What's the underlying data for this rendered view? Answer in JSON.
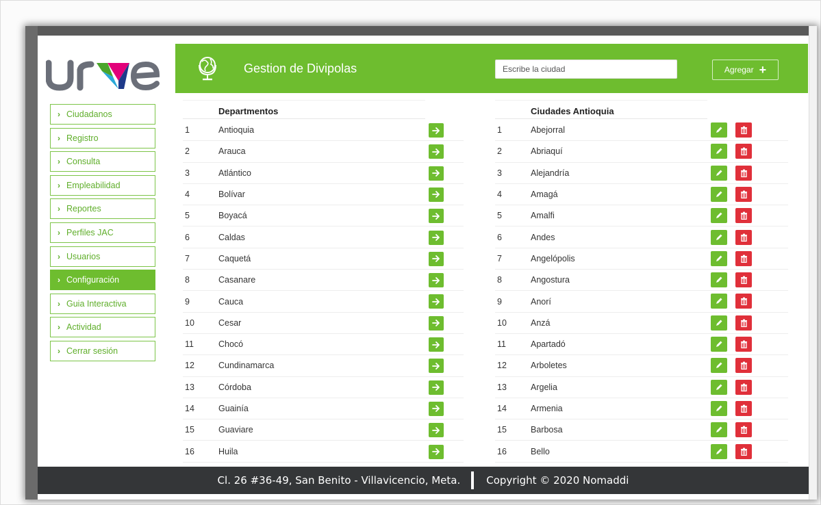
{
  "brand": {
    "logo_text": "URVE"
  },
  "header": {
    "title": "Gestion de Divipolas",
    "search_placeholder": "Escribe la ciudad",
    "add_label": "Agregar",
    "accent_color": "#6ebd2f"
  },
  "sidebar": {
    "items": [
      {
        "label": "Ciudadanos",
        "active": false
      },
      {
        "label": "Registro",
        "active": false
      },
      {
        "label": "Consulta",
        "active": false
      },
      {
        "label": "Empleabilidad",
        "active": false
      },
      {
        "label": "Reportes",
        "active": false
      },
      {
        "label": "Perfiles JAC",
        "active": false
      },
      {
        "label": "Usuarios",
        "active": false
      },
      {
        "label": "Configuración",
        "active": true
      },
      {
        "label": "Guia Interactiva",
        "active": false
      },
      {
        "label": "Actividad",
        "active": false
      },
      {
        "label": "Cerrar sesión",
        "active": false
      }
    ]
  },
  "departments": {
    "header": "Departmentos",
    "rows": [
      {
        "num": "1",
        "name": "Antioquia"
      },
      {
        "num": "2",
        "name": "Arauca"
      },
      {
        "num": "3",
        "name": "Atlántico"
      },
      {
        "num": "4",
        "name": "Bolívar"
      },
      {
        "num": "5",
        "name": "Boyacá"
      },
      {
        "num": "6",
        "name": "Caldas"
      },
      {
        "num": "7",
        "name": "Caquetá"
      },
      {
        "num": "8",
        "name": "Casanare"
      },
      {
        "num": "9",
        "name": "Cauca"
      },
      {
        "num": "10",
        "name": "Cesar"
      },
      {
        "num": "11",
        "name": "Chocó"
      },
      {
        "num": "12",
        "name": "Cundinamarca"
      },
      {
        "num": "13",
        "name": "Córdoba"
      },
      {
        "num": "14",
        "name": "Guainía"
      },
      {
        "num": "15",
        "name": "Guaviare"
      },
      {
        "num": "16",
        "name": "Huila"
      }
    ]
  },
  "cities": {
    "header": "Ciudades Antioquia",
    "rows": [
      {
        "num": "1",
        "name": "Abejorral"
      },
      {
        "num": "2",
        "name": "Abriaquí"
      },
      {
        "num": "3",
        "name": "Alejandría"
      },
      {
        "num": "4",
        "name": "Amagá"
      },
      {
        "num": "5",
        "name": "Amalfi"
      },
      {
        "num": "6",
        "name": "Andes"
      },
      {
        "num": "7",
        "name": "Angelópolis"
      },
      {
        "num": "8",
        "name": "Angostura"
      },
      {
        "num": "9",
        "name": "Anorí"
      },
      {
        "num": "10",
        "name": "Anzá"
      },
      {
        "num": "11",
        "name": "Apartadó"
      },
      {
        "num": "12",
        "name": "Arboletes"
      },
      {
        "num": "13",
        "name": "Argelia"
      },
      {
        "num": "14",
        "name": "Armenia"
      },
      {
        "num": "15",
        "name": "Barbosa"
      },
      {
        "num": "16",
        "name": "Bello"
      }
    ]
  },
  "footer": {
    "address": "Cl. 26 #36-49, San Benito - Villavicencio, Meta.",
    "copyright": "Copyright © 2020 Nomaddi"
  },
  "icons": {
    "globe": "globe-icon",
    "arrow": "arrow-right-icon",
    "edit": "pencil-icon",
    "delete": "trash-icon",
    "chevron": "chevron-right-icon",
    "plus": "plus-icon"
  },
  "colors": {
    "green": "#6ebd2f",
    "red": "#e0303a",
    "footer": "#343638"
  }
}
